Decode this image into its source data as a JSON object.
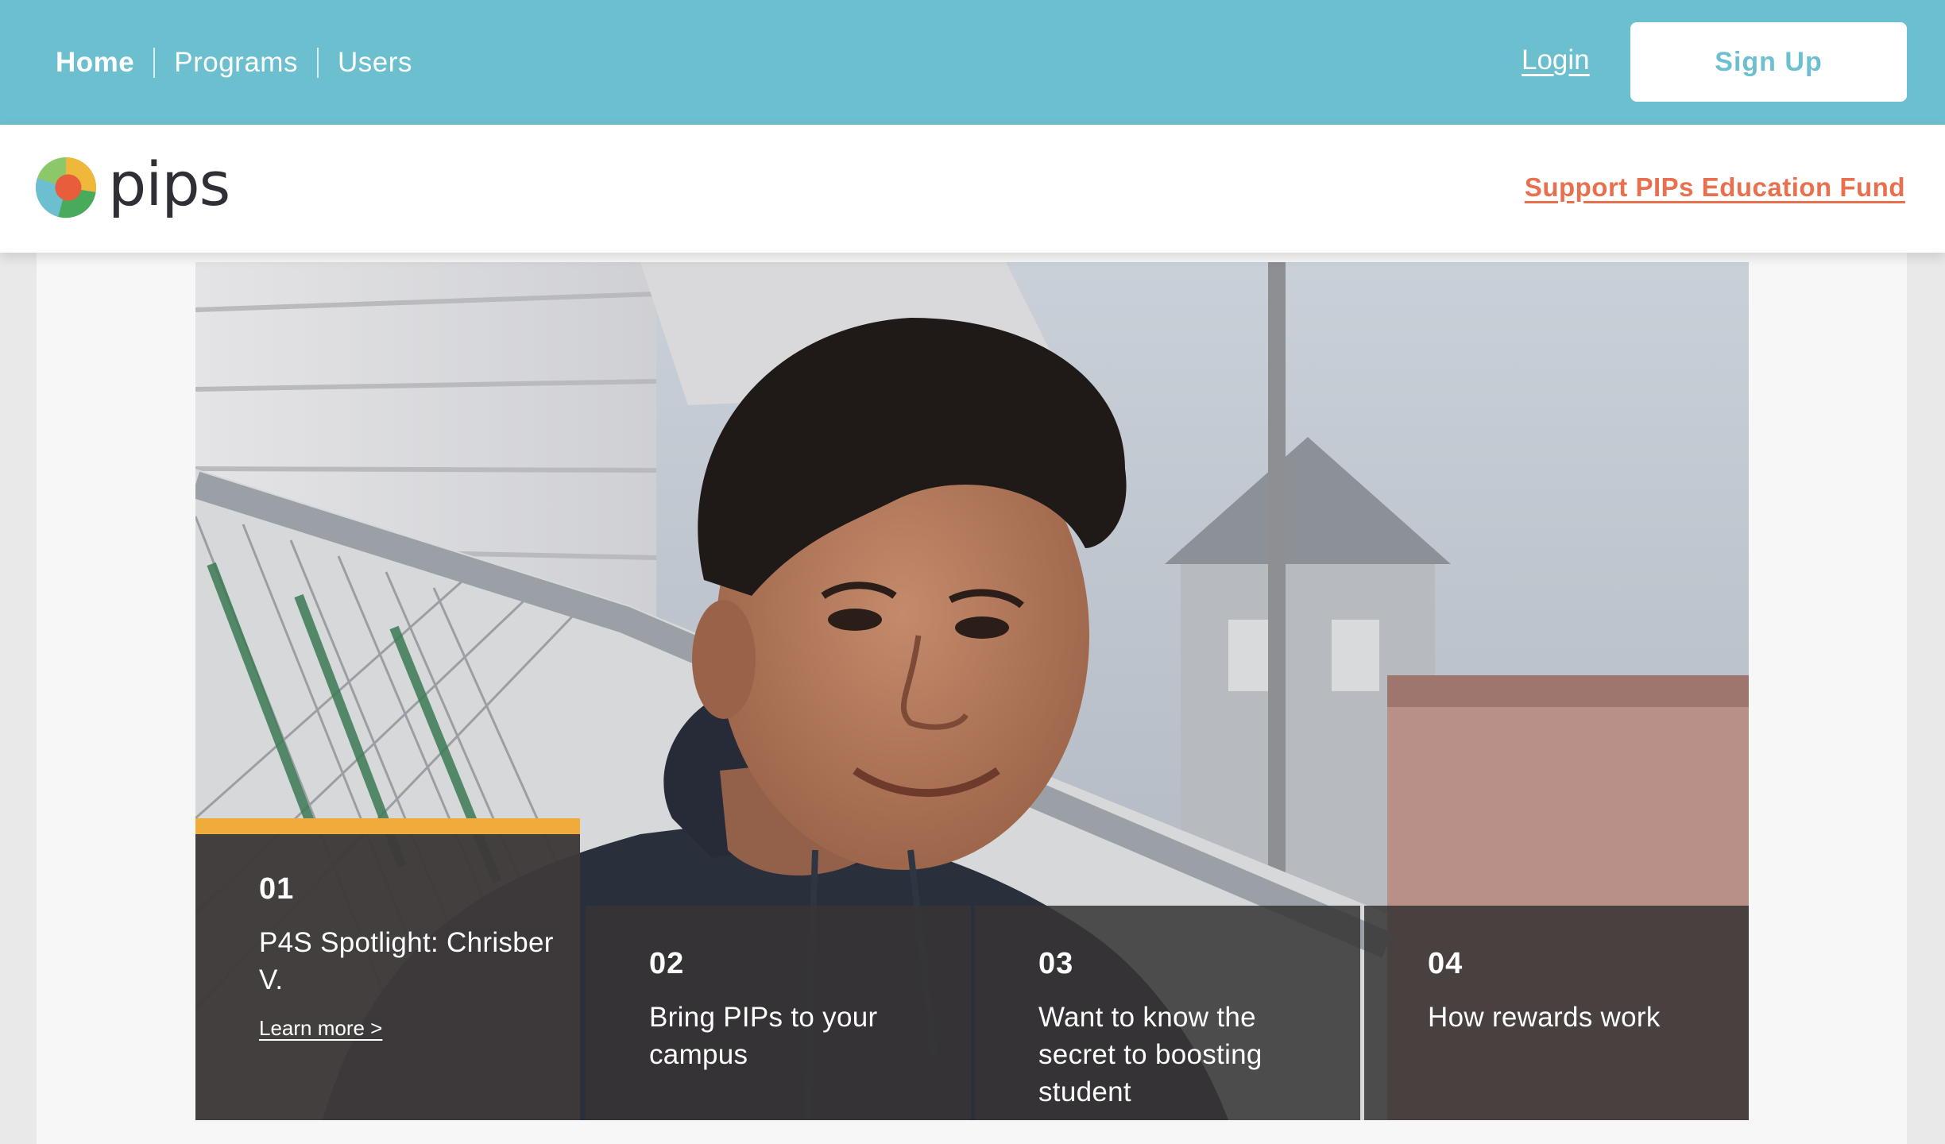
{
  "nav": {
    "home": "Home",
    "programs": "Programs",
    "users": "Users",
    "login": "Login",
    "signup": "Sign Up"
  },
  "brand": {
    "logo_text": "pips",
    "support_link": "Support PIPs Education Fund"
  },
  "slides": [
    {
      "num": "01",
      "title": "P4S Spotlight: Chrisber V.",
      "link": "Learn more >",
      "active": true
    },
    {
      "num": "02",
      "title": "Bring PIPs to your campus"
    },
    {
      "num": "03",
      "title": "Want to know the secret to boosting student"
    },
    {
      "num": "04",
      "title": "How rewards work"
    }
  ],
  "colors": {
    "topbar": "#6cbfcf",
    "accent_orange": "#e9704e",
    "active_bar": "#f0ab3a",
    "tab_bg": "#3e3a3a"
  }
}
